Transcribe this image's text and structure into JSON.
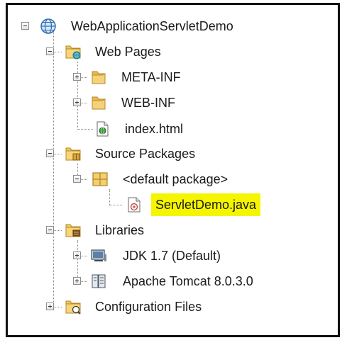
{
  "project_tree": {
    "root": {
      "label": "WebApplicationServletDemo",
      "icon": "globe-icon"
    },
    "web_pages": {
      "label": "Web Pages",
      "icon": "web-folder-icon",
      "children": [
        {
          "label": "META-INF",
          "icon": "folder-icon"
        },
        {
          "label": "WEB-INF",
          "icon": "folder-icon"
        },
        {
          "label": "index.html",
          "icon": "html-file-icon"
        }
      ]
    },
    "source_packages": {
      "label": "Source Packages",
      "icon": "package-folder-icon",
      "children": [
        {
          "label": "<default package>",
          "icon": "package-icon",
          "children": [
            {
              "label": "ServletDemo.java",
              "icon": "java-file-icon",
              "highlight_color": "#f5f500"
            }
          ]
        }
      ]
    },
    "libraries": {
      "label": "Libraries",
      "icon": "library-folder-icon",
      "children": [
        {
          "label": "JDK 1.7 (Default)",
          "icon": "jdk-icon"
        },
        {
          "label": "Apache Tomcat 8.0.3.0",
          "icon": "server-library-icon"
        }
      ]
    },
    "configuration_files": {
      "label": "Configuration Files",
      "icon": "config-folder-icon"
    }
  }
}
